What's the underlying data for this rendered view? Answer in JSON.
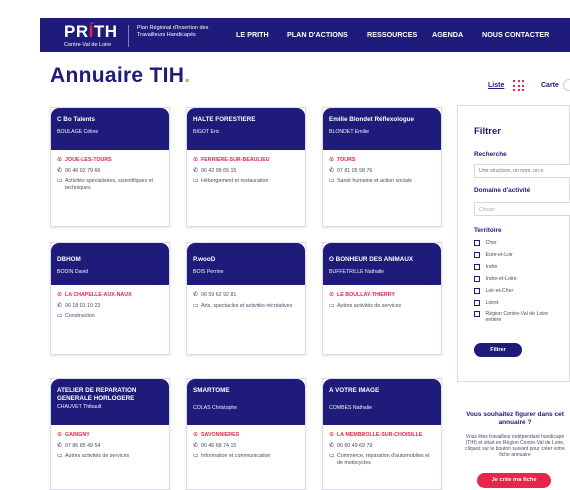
{
  "header": {
    "logo_main": "PRÍTH",
    "logo_sub": "Centre-Val de Loire",
    "logo_text": "Plan Régional d'Insertion des Travailleurs Handicapés",
    "nav": [
      "LE PRITH",
      "PLAN D'ACTIONS",
      "RESSOURCES",
      "AGENDA",
      "NOUS CONTACTER"
    ]
  },
  "page": {
    "title": "Annuaire TIH",
    "title_dot": "."
  },
  "view": {
    "list_label": "Liste",
    "map_label": "Carte"
  },
  "cards": [
    {
      "name": "C Bo Talents",
      "contact": "BOULAGE Céline",
      "city": "JOUE-LES-TOURS",
      "phone": "06 46 92 79 66",
      "activity": "Activités spécialisées, scientifiques et techniques"
    },
    {
      "name": "HALTE FORESTIERE",
      "contact": "BIGOT Eric",
      "city": "FERRIERE-SUR-BEAULIEU",
      "phone": "06 42 99 65 15",
      "activity": "Hébergement et restauration"
    },
    {
      "name": "Emilie Blondet Réflexologue",
      "contact": "BLONDET Emilie",
      "city": "TOURS",
      "phone": "07 81 05 58 76",
      "activity": "Santé humaine et action sociale"
    },
    {
      "name": "DBHOM",
      "contact": "BODIN David",
      "city": "LA CHAPELLE-AUX-NAUX",
      "phone": "06 18 01 10 23",
      "activity": "Construction"
    },
    {
      "name": "P.wooD",
      "contact": "BOIS Perrine",
      "city": "",
      "phone": "06 59 62 92 81",
      "activity": "Arts, spectacles et activités récréatives"
    },
    {
      "name": "O BONHEUR DES ANIMAUX",
      "contact": "BUFFETRILLE Nathalie",
      "city": "LE BOULLAY-THIERRY",
      "phone": "",
      "activity": "Autres activités de services"
    },
    {
      "name": "ATELIER DE REPARATION GENERALE HORLOGERE",
      "contact": "CHAUVET Thibault",
      "city": "GARIGNY",
      "phone": "07 86 85 49 54",
      "activity": "Autres activités de services"
    },
    {
      "name": "SMARTOME",
      "contact": "COLAS Christophe",
      "city": "SAVONNIERES",
      "phone": "06 46 68 74 15",
      "activity": "Information et communication"
    },
    {
      "name": "A VOTRE IMAGE",
      "contact": "COMBES Nathalie",
      "city": "LA MEMBROLLE-SUR-CHOISILLE",
      "phone": "06 60 49 69 79",
      "activity": "Commerce, réparation d'automobiles et de motocycles"
    }
  ],
  "filter": {
    "title": "Filtrer",
    "search_label": "Recherche",
    "search_placeholder": "Une structure, un nom, un s",
    "domain_label": "Domaine d'activité",
    "domain_value": "Choisir",
    "territory_label": "Territoire",
    "territories": [
      "Cher",
      "Eure-et-Loir",
      "Indre",
      "Indre-et-Loire",
      "Loir-et-Cher",
      "Loiret",
      "Région Centre-Val de Loire entière"
    ],
    "button": "Filtrer"
  },
  "promo": {
    "title": "Vous souhaitez figurer dans cet annuaire ?",
    "text": "Vous êtes travailleur indépendant handicapé (TIH) et situé en Région Centre-Val de Loire, cliquez sur le bouton suivant pour créer votre fiche annuaire",
    "button": "Je crée ma fiche"
  },
  "colors": {
    "brand": "#1f1b7a",
    "accent": "#e8254a",
    "title_dot": "#f0a13c"
  }
}
